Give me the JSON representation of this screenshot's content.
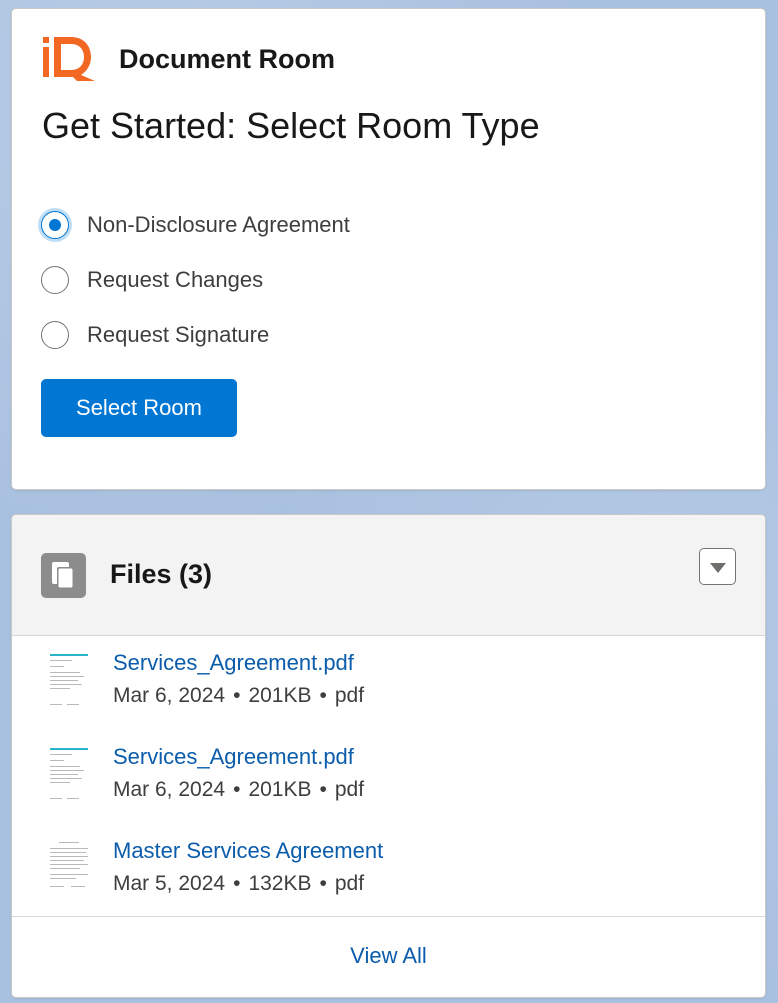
{
  "app": {
    "title": "Document Room",
    "logo_text": "iD",
    "brand_color": "#f26722"
  },
  "room_selector": {
    "heading": "Get Started: Select Room Type",
    "options": [
      {
        "label": "Non-Disclosure Agreement",
        "checked": true
      },
      {
        "label": "Request Changes",
        "checked": false
      },
      {
        "label": "Request Signature",
        "checked": false
      }
    ],
    "button_label": "Select Room",
    "accent_color": "#0176d3"
  },
  "files": {
    "title": "Files (3)",
    "icon": "files-icon",
    "items": [
      {
        "name": "Services_Agreement.pdf",
        "date": "Mar 6, 2024",
        "size": "201KB",
        "type": "pdf"
      },
      {
        "name": "Services_Agreement.pdf",
        "date": "Mar 6, 2024",
        "size": "201KB",
        "type": "pdf"
      },
      {
        "name": "Master Services Agreement",
        "date": "Mar 5, 2024",
        "size": "132KB",
        "type": "pdf"
      }
    ],
    "separator": "•",
    "view_all_label": "View All"
  }
}
